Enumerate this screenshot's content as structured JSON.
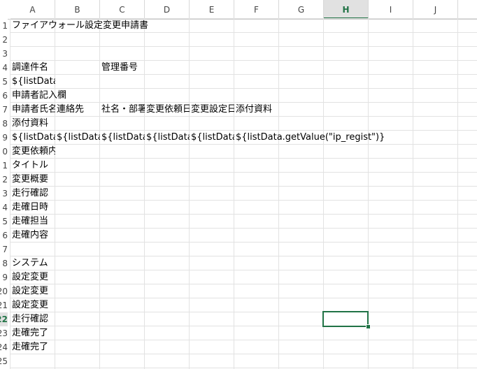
{
  "columns": [
    "A",
    "B",
    "C",
    "D",
    "E",
    "F",
    "G",
    "H",
    "I",
    "J"
  ],
  "selected_column": "H",
  "rows": [
    "1",
    "2",
    "3",
    "4",
    "5",
    "6",
    "7",
    "8",
    "9",
    "10",
    "11",
    "12",
    "13",
    "14",
    "15",
    "16",
    "17",
    "18",
    "19",
    "20",
    "21",
    "22",
    "23",
    "24",
    "25"
  ],
  "selected_row": "22",
  "row_header_visible_digits": [
    "1",
    "2",
    "3",
    "4",
    "5",
    "6",
    "7",
    "8",
    "9",
    "0",
    "1",
    "2",
    "3",
    "4",
    "5",
    "6",
    "7",
    "8",
    "9",
    "20",
    "21",
    "22",
    "23",
    "24",
    "25"
  ],
  "cells": [
    {
      "row": 1,
      "col": "A",
      "text": "ファイアウォール設定変更申請書",
      "spill": true
    },
    {
      "row": 4,
      "col": "A",
      "text": "調達件名"
    },
    {
      "row": 4,
      "col": "C",
      "text": "管理番号"
    },
    {
      "row": 5,
      "col": "A",
      "text": "${listData.getValue(\"title\")}"
    },
    {
      "row": 6,
      "col": "A",
      "text": "申請者記入欄",
      "spill": true
    },
    {
      "row": 7,
      "col": "A",
      "text": "申請者氏名"
    },
    {
      "row": 7,
      "col": "B",
      "text": "連絡先"
    },
    {
      "row": 7,
      "col": "C",
      "text": "社名・部署"
    },
    {
      "row": 7,
      "col": "D",
      "text": "変更依頼日"
    },
    {
      "row": 7,
      "col": "E",
      "text": "変更設定日"
    },
    {
      "row": 7,
      "col": "F",
      "text": "添付資料",
      "spill": true
    },
    {
      "row": 8,
      "col": "A",
      "text": "添付資料",
      "spill": true
    },
    {
      "row": 9,
      "col": "A",
      "text": "${listData.getValue(\"name\")}"
    },
    {
      "row": 9,
      "col": "B",
      "text": "${listData.getValue(\"tel\")}"
    },
    {
      "row": 9,
      "col": "C",
      "text": "${listData.getValue(\"dept\")}"
    },
    {
      "row": 9,
      "col": "D",
      "text": "${listData.getValue(\"req_date\")}"
    },
    {
      "row": 9,
      "col": "E",
      "text": "${listData.getValue(\"set_date\")}"
    },
    {
      "row": 9,
      "col": "F",
      "text": "${listData.getValue(\"ip_regist\")}",
      "spill": true
    },
    {
      "row": 10,
      "col": "A",
      "text": "変更依頼内容"
    },
    {
      "row": 11,
      "col": "A",
      "text": "タイトル"
    },
    {
      "row": 12,
      "col": "A",
      "text": "変更概要"
    },
    {
      "row": 13,
      "col": "A",
      "text": "走行確認"
    },
    {
      "row": 14,
      "col": "A",
      "text": "走確日時"
    },
    {
      "row": 15,
      "col": "A",
      "text": "走確担当"
    },
    {
      "row": 16,
      "col": "A",
      "text": "走確内容"
    },
    {
      "row": 18,
      "col": "A",
      "text": "システム"
    },
    {
      "row": 19,
      "col": "A",
      "text": "設定変更"
    },
    {
      "row": 20,
      "col": "A",
      "text": "設定変更"
    },
    {
      "row": 21,
      "col": "A",
      "text": "設定変更"
    },
    {
      "row": 22,
      "col": "A",
      "text": "走行確認"
    },
    {
      "row": 23,
      "col": "A",
      "text": "走確完了"
    },
    {
      "row": 24,
      "col": "A",
      "text": "走確完了"
    }
  ],
  "selected_cell": "H22",
  "accent_color": "#217346"
}
